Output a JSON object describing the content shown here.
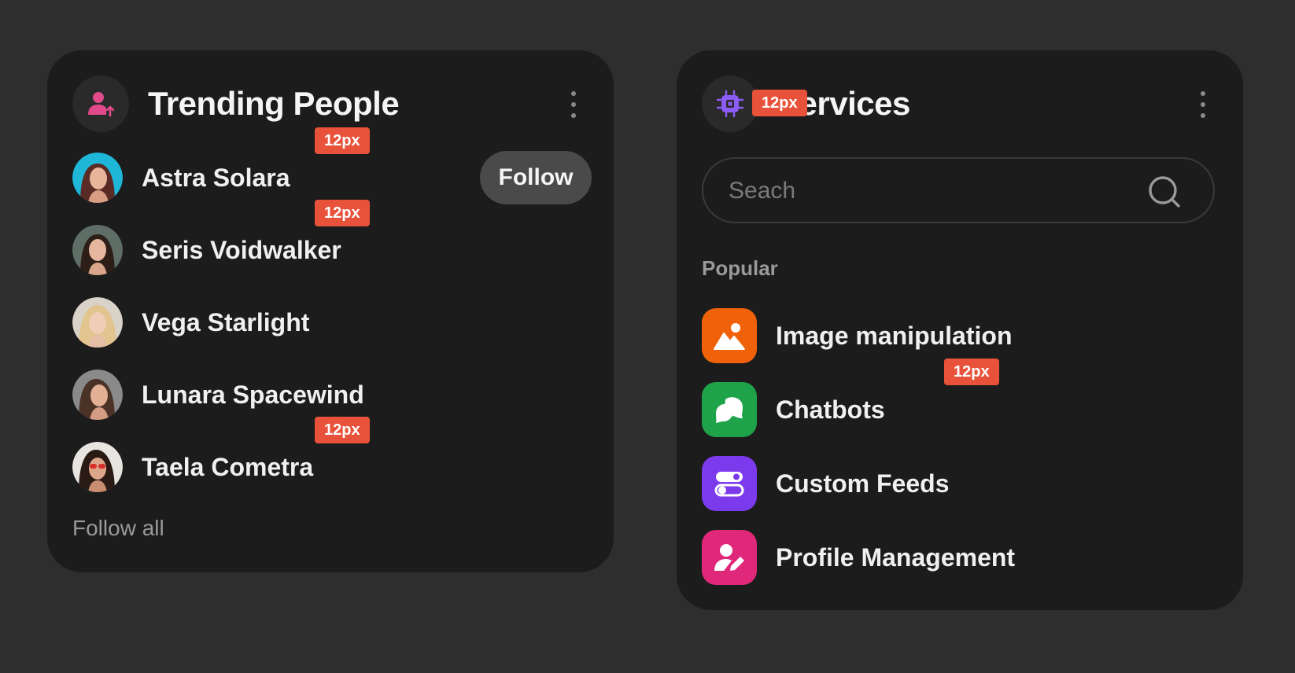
{
  "trending": {
    "title": "Trending People",
    "people": [
      {
        "name": "Astra Solara"
      },
      {
        "name": "Seris Voidwalker"
      },
      {
        "name": "Vega Starlight"
      },
      {
        "name": "Lunara Spacewind"
      },
      {
        "name": "Taela Cometra"
      }
    ],
    "follow_label": "Follow",
    "follow_all_label": "Follow all"
  },
  "services": {
    "title": "Services",
    "search_placeholder": "Seach",
    "popular_label": "Popular",
    "items": [
      {
        "label": "Image manipulation",
        "icon": "image-icon",
        "color": "#f0620a"
      },
      {
        "label": "Chatbots",
        "icon": "chat-icon",
        "color": "#1fa34a"
      },
      {
        "label": "Custom Feeds",
        "icon": "toggles-icon",
        "color": "#7c3aed"
      },
      {
        "label": "Profile Management",
        "icon": "profile-edit-icon",
        "color": "#e0287a"
      }
    ]
  },
  "spacing_badges": {
    "label": "12px"
  },
  "colors": {
    "background": "#2e2e2e",
    "card": "#1c1c1c",
    "badge": "#e8523a",
    "trending_icon": "#e04a8a",
    "services_icon": "#8b5cf6"
  }
}
